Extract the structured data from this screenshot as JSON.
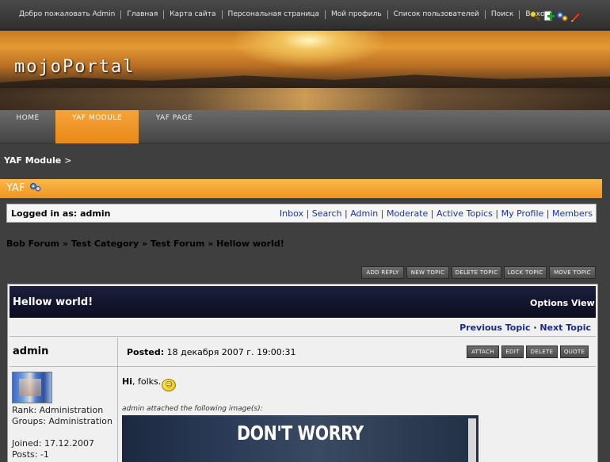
{
  "topbar": {
    "links": [
      "Добро пожаловать Admin",
      "Главная",
      "Карта сайта",
      "Персональная страница",
      "Мой профиль",
      "Список пользователей",
      "Поиск",
      "Выход"
    ],
    "icons": [
      "key-icon",
      "add-page-icon",
      "settings-gears-icon",
      "edit-pencil-icon"
    ]
  },
  "banner": {
    "logo": "mojoPortal"
  },
  "nav": {
    "tabs": [
      {
        "label": "HOME"
      },
      {
        "label": "YAF MODULE",
        "active": true
      },
      {
        "label": "YAF PAGE"
      }
    ]
  },
  "breadcrumb": {
    "page": "YAF Module",
    "sep": ">"
  },
  "yaf": {
    "title": "YAF"
  },
  "login": {
    "who": "Logged in as: admin",
    "links": [
      "Inbox",
      "Search",
      "Admin",
      "Moderate",
      "Active Topics",
      "My Profile",
      "Members"
    ]
  },
  "forum_crumb": "Bob Forum » Test Category » Test Forum » Hellow world!",
  "actions": [
    "ADD REPLY",
    "NEW TOPIC",
    "DELETE TOPIC",
    "LOCK TOPIC",
    "MOVE TOPIC"
  ],
  "topic": {
    "title": "Hellow world!",
    "options": "Options",
    "view": "View",
    "prev": "Previous Topic",
    "dot": "·",
    "next": "Next Topic"
  },
  "post": {
    "author": "admin",
    "posted_label": "Posted:",
    "posted_value": "18 декабря 2007 г. 19:00:31",
    "buttons": [
      "ATTACH",
      "EDIT",
      "DELETE",
      "QUOTE"
    ],
    "rank": "Rank: Administration",
    "groups": "Groups: Administration",
    "joined": "Joined: 17.12.2007",
    "posts": "Posts: -1",
    "msg_bold": "Hi",
    "msg_rest": ", folks.",
    "attach_note": "admin attached the following image(s):",
    "image_text": "DON'T WORRY"
  },
  "colors": {
    "accent_orange": "#f09420",
    "link_blue": "#1a33b0",
    "topic_header": "#0c0d20"
  }
}
